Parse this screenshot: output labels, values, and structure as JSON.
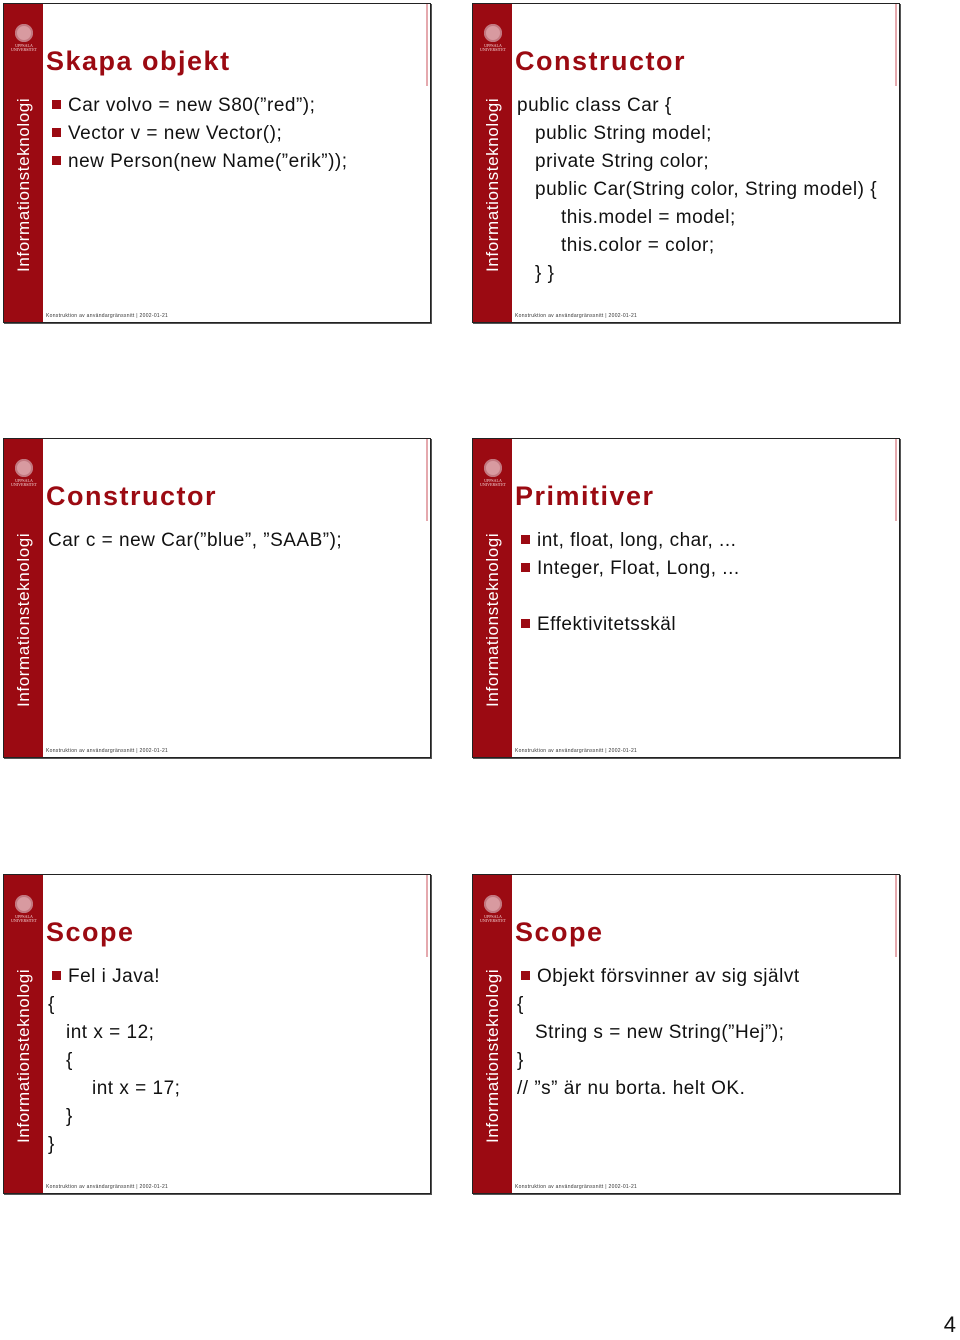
{
  "sidebar_label": "Informationsteknologi",
  "logo_text": "UPPSALA UNIVERSITET",
  "footer": "Konstruktion av användargränssnitt | 2002-01-21",
  "page_number": "4",
  "colors": {
    "accent": "#9b0a12",
    "text": "#111111"
  },
  "slides": [
    {
      "title": "Skapa objekt",
      "lines": [
        {
          "text": "Car volvo = new S80(”red”);",
          "bullet": true,
          "indent": 0
        },
        {
          "text": "Vector v = new Vector();",
          "bullet": true,
          "indent": 0
        },
        {
          "text": "new Person(new Name(”erik”));",
          "bullet": true,
          "indent": 0
        }
      ]
    },
    {
      "title": "Constructor",
      "lines": [
        {
          "text": "public class Car {",
          "bullet": false,
          "indent": 0
        },
        {
          "text": "public String model;",
          "bullet": false,
          "indent": 1
        },
        {
          "text": "private String color;",
          "bullet": false,
          "indent": 1
        },
        {
          "text": "public Car(String color, String model) {",
          "bullet": false,
          "indent": 1,
          "wrap": true
        },
        {
          "text": "this.model = model;",
          "bullet": false,
          "indent": 2
        },
        {
          "text": "this.color = color;",
          "bullet": false,
          "indent": 2
        },
        {
          "text": "} }",
          "bullet": false,
          "indent": 1
        }
      ]
    },
    {
      "title": "Constructor",
      "lines": [
        {
          "text": "Car c = new Car(”blue”, ”SAAB”);",
          "bullet": false,
          "indent": 0
        }
      ]
    },
    {
      "title": "Primitiver",
      "lines": [
        {
          "text": "int, float, long, char, ...",
          "bullet": true,
          "indent": 0
        },
        {
          "text": "Integer, Float, Long, ...",
          "bullet": true,
          "indent": 0
        },
        {
          "text": "",
          "bullet": false,
          "indent": 0
        },
        {
          "text": "Effektivitetsskäl",
          "bullet": true,
          "indent": 0
        }
      ]
    },
    {
      "title": "Scope",
      "lines": [
        {
          "text": "Fel i Java!",
          "bullet": true,
          "indent": 0
        },
        {
          "text": "{",
          "bullet": false,
          "indent": 0
        },
        {
          "text": "int x = 12;",
          "bullet": false,
          "indent": 1
        },
        {
          "text": "{",
          "bullet": false,
          "indent": 1
        },
        {
          "text": "int x = 17;",
          "bullet": false,
          "indent": 2
        },
        {
          "text": "}",
          "bullet": false,
          "indent": 1
        },
        {
          "text": "}",
          "bullet": false,
          "indent": 0
        }
      ]
    },
    {
      "title": "Scope",
      "lines": [
        {
          "text": "Objekt försvinner av sig självt",
          "bullet": true,
          "indent": 0
        },
        {
          "text": "{",
          "bullet": false,
          "indent": 0
        },
        {
          "text": "String s = new String(”Hej”);",
          "bullet": false,
          "indent": 1
        },
        {
          "text": "}",
          "bullet": false,
          "indent": 0
        },
        {
          "text": "// ”s” är nu borta. helt OK.",
          "bullet": false,
          "indent": 0
        }
      ]
    }
  ]
}
